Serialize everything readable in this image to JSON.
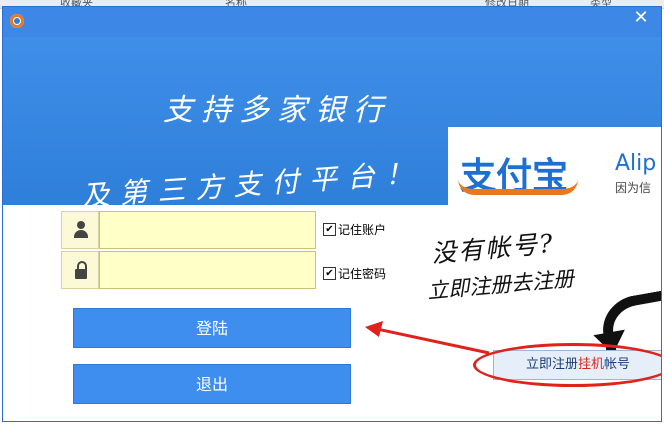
{
  "background": {
    "col1": "收藏夹",
    "col2": "名称",
    "col3": "修改日期",
    "col4": "类型"
  },
  "titlebar": {
    "close_label": "✕"
  },
  "banner": {
    "slogan_line1": "支持多家银行",
    "slogan_line2": "及第三方支付平台！",
    "alipay_logo": "支付宝",
    "alipay_en": "Alip",
    "alipay_sub": "因为信"
  },
  "login": {
    "username": {
      "value": "",
      "icon": "person-icon"
    },
    "password": {
      "value": "",
      "icon": "lock-icon"
    },
    "remember_account": {
      "label": "记住账户",
      "checked": true
    },
    "remember_password": {
      "label": "记住密码",
      "checked": true
    },
    "login_button": "登陆",
    "exit_button": "退出"
  },
  "promo": {
    "no_account": "没有帐号?",
    "register_now": "立即注册去注册"
  },
  "register_link": {
    "part1": "立即注册",
    "part2": "挂机",
    "part3": "帐号"
  },
  "colors": {
    "accent": "#3e8ef0",
    "titlebar": "#3d88e6",
    "annotation": "#e0211c"
  }
}
